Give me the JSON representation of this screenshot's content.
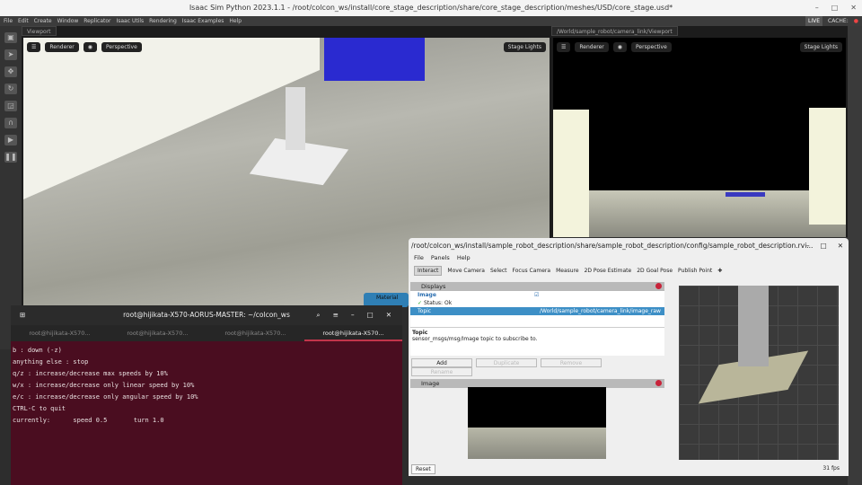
{
  "app": {
    "title": "Isaac Sim Python 2023.1.1 - /root/colcon_ws/install/core_stage_description/share/core_stage_description/meshes/USD/core_stage.usd*",
    "menu": [
      "File",
      "Edit",
      "Create",
      "Window",
      "Replicator",
      "Isaac Utils",
      "Rendering",
      "Isaac Examples",
      "Help"
    ],
    "status": {
      "live": "LIVE",
      "cache": "CACHE:"
    }
  },
  "viewport1": {
    "tab": "Viewport",
    "renderer": "Renderer",
    "camera": "Perspective",
    "lights": "Stage Lights"
  },
  "viewport2": {
    "tab": "/World/sample_robot/camera_link/Viewport",
    "renderer": "Renderer",
    "camera": "Perspective",
    "lights": "Stage Lights"
  },
  "notice": {
    "text": "Material"
  },
  "terminal": {
    "title": "root@hijikata-X570-AORUS-MASTER: ~/colcon_ws",
    "tabs": [
      "root@hijikata-X570...",
      "root@hijikata-X570...",
      "root@hijikata-X570...",
      "root@hijikata-X570..."
    ],
    "lines": [
      "b : down (-z)",
      "",
      "anything else : stop",
      "",
      "q/z : increase/decrease max speeds by 10%",
      "w/x : increase/decrease only linear speed by 10%",
      "e/c : increase/decrease only angular speed by 10%",
      "",
      "CTRL-C to quit",
      "",
      "currently:      speed 0.5       turn 1.0"
    ]
  },
  "rviz": {
    "title": "/root/colcon_ws/install/sample_robot_description/share/sample_robot_description/config/sample_robot_description.rvi...",
    "menu": [
      "File",
      "Panels",
      "Help"
    ],
    "tools": [
      "Interact",
      "Move Camera",
      "Select",
      "Focus Camera",
      "Measure",
      "2D Pose Estimate",
      "2D Goal Pose",
      "Publish Point"
    ],
    "displays": {
      "title": "Displays",
      "image": "Image",
      "status": "Status: Ok",
      "topic_label": "Topic",
      "topic_value": "/World/sample_robot/camera_link/image_raw",
      "desc_title": "Topic",
      "desc": "sensor_msgs/msg/Image topic to subscribe to.",
      "buttons": [
        "Add",
        "Duplicate",
        "Remove",
        "Rename"
      ]
    },
    "image_panel": {
      "title": "Image"
    },
    "reset": "Reset",
    "fps": "31 fps"
  }
}
